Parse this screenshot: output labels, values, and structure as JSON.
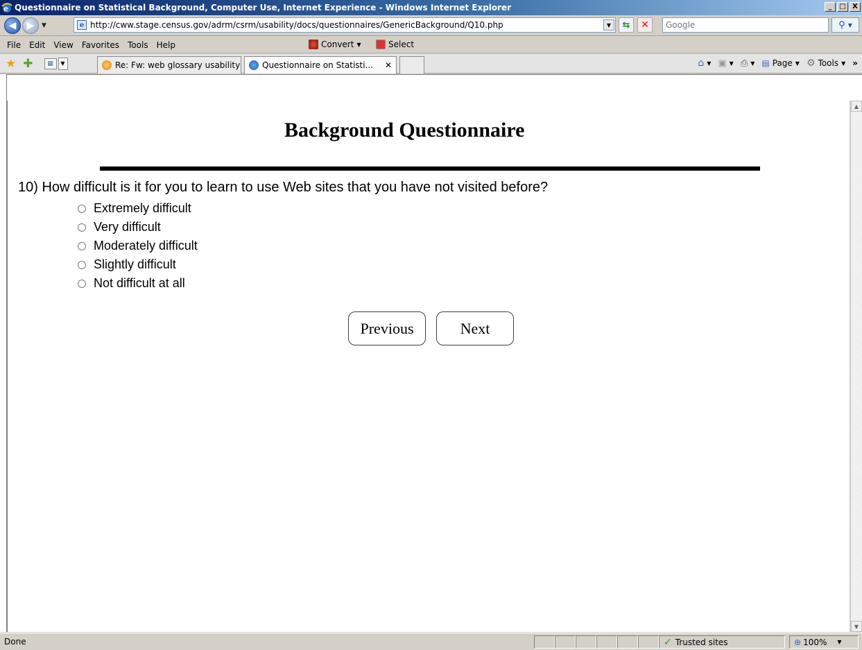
{
  "window": {
    "title": "Questionnaire on Statistical Background, Computer Use, Internet Experience - Windows Internet Explorer",
    "controls": [
      "_",
      "□",
      "X"
    ]
  },
  "address": {
    "url": "http://cww.stage.census.gov/adrm/csrm/usability/docs/questionnaires/GenericBackground/Q10.php",
    "search_placeholder": "Google"
  },
  "menu": {
    "items": [
      "File",
      "Edit",
      "View",
      "Favorites",
      "Tools",
      "Help"
    ],
    "convert_label": "Convert",
    "select_label": "Select"
  },
  "tabs": [
    {
      "label": "Re: Fw: web glossary usability"
    },
    {
      "label": "Questionnaire on Statisti..."
    }
  ],
  "commandbar": {
    "page_label": "Page",
    "tools_label": "Tools"
  },
  "page": {
    "title": "Background Questionnaire",
    "question": "10) How difficult is it for you to learn to use Web sites that you have not visited before?",
    "options": [
      "Extremely difficult",
      "Very difficult",
      "Moderately difficult",
      "Slightly difficult",
      "Not difficult at all"
    ],
    "previous_label": "Previous",
    "next_label": "Next"
  },
  "status": {
    "text": "Done",
    "zone": "Trusted sites",
    "zoom": "100%"
  }
}
